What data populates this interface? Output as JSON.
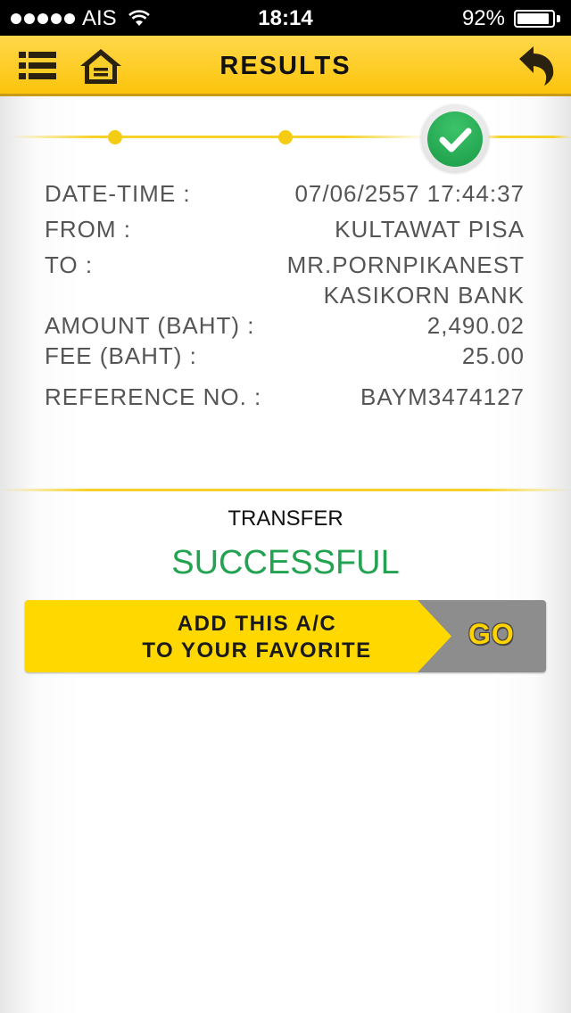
{
  "status_bar": {
    "carrier": "AIS",
    "time": "18:14",
    "battery": "92%",
    "battery_level": 0.92
  },
  "header": {
    "title": "RESULTS",
    "menu_icon": "list-icon",
    "home_icon": "home-icon",
    "back_icon": "undo-arrow-icon"
  },
  "progress": {
    "steps_total": 3,
    "current_step": 3,
    "complete_icon": "check-icon"
  },
  "details": [
    {
      "label": "DATE-TIME :",
      "value": "07/06/2557 17:44:37"
    },
    {
      "label": "FROM :",
      "value": "KULTAWAT PISA"
    },
    {
      "label": "TO :",
      "value": "MR.PORNPIKANEST"
    },
    {
      "label": "",
      "value": "KASIKORN BANK"
    },
    {
      "label": "AMOUNT (BAHT) :",
      "value": "2,490.02"
    },
    {
      "label": "FEE (BAHT) :",
      "value": "25.00"
    },
    {
      "label": "REFERENCE NO. :",
      "value": "BAYM3474127"
    }
  ],
  "result": {
    "label": "TRANSFER",
    "status": "SUCCESSFUL"
  },
  "favorite": {
    "line1": "ADD THIS A/C",
    "line2": "TO YOUR FAVORITE",
    "go_label": "GO"
  },
  "colors": {
    "brand_yellow": "#fcc40b",
    "success_green": "#23a351",
    "banner_gray": "#8d8d8d"
  }
}
